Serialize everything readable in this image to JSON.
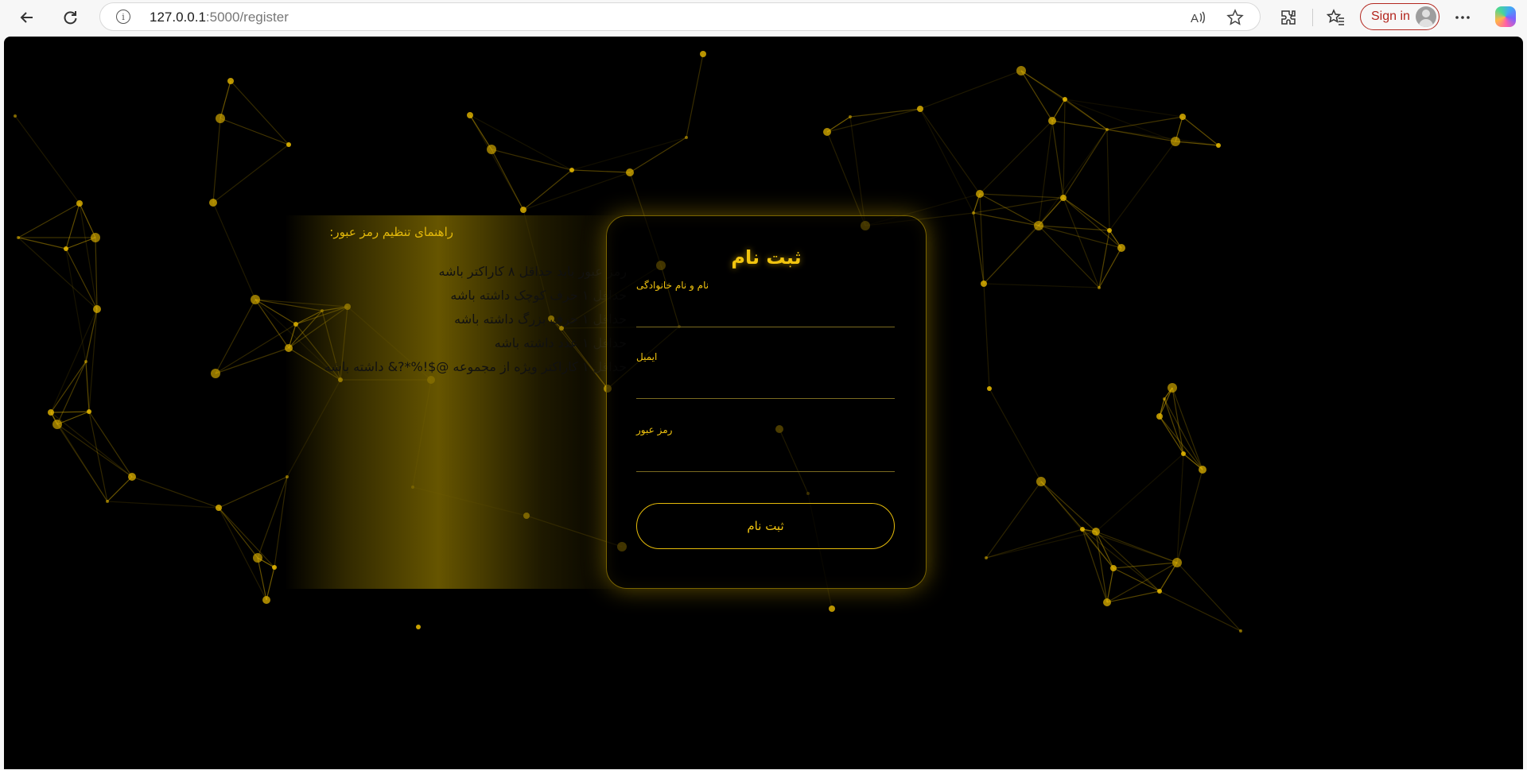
{
  "browser": {
    "url_host": "127.0.0.1",
    "url_path": ":5000/register",
    "sign_in_label": "Sign in",
    "icons": [
      "back-arrow-icon",
      "refresh-icon",
      "site-info-icon",
      "read-aloud-icon",
      "favorite-star-icon",
      "extensions-icon",
      "favorites-icon",
      "more-icon",
      "copilot-icon"
    ]
  },
  "guide": {
    "title": "راهنمای تنظیم رمز عبور:",
    "rules": [
      "رمز عبور باید حداقل ۸ کاراکتر باشه",
      "حداقل ۱ حرف کوچک داشته باشه",
      "حداقل ۱ حرف بزرگ داشته باشه",
      "حداقل ۱ عدد داشته باشه",
      "حداقل ۱ کاراکتر ویژه از مجموعه @$!%*?& داشته باشه"
    ]
  },
  "form": {
    "title": "ثبت نام",
    "fullname_label": "نام و نام خانوادگی",
    "fullname_value": "",
    "email_label": "ایمیل",
    "email_value": "",
    "password_label": "رمز عبور",
    "password_value": "",
    "submit_label": "ثبت نام"
  },
  "theme": {
    "accent": "#f1c40f",
    "background": "#000000",
    "particle_color": "#e6b800"
  }
}
